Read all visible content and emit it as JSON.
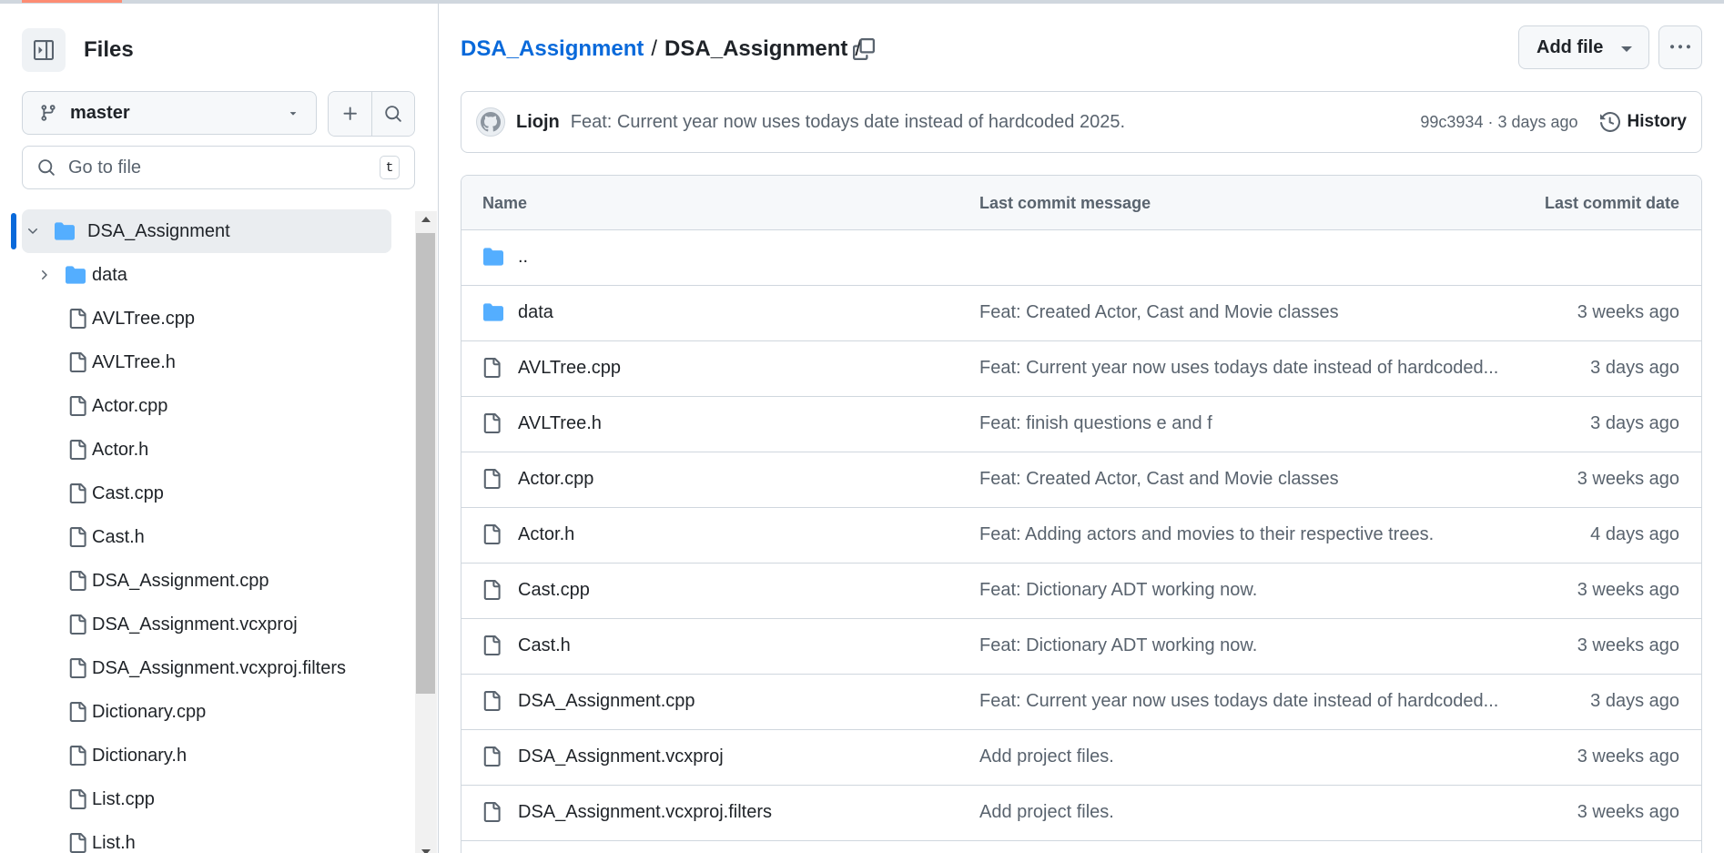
{
  "sidebar": {
    "title": "Files",
    "branch": "master",
    "search_placeholder": "Go to file",
    "search_shortcut": "t",
    "tree": [
      {
        "label": "DSA_Assignment",
        "type": "folder-open",
        "depth": 0,
        "expanded": true,
        "active": true
      },
      {
        "label": "data",
        "type": "folder",
        "depth": 1,
        "expanded": false
      },
      {
        "label": "AVLTree.cpp",
        "type": "file",
        "depth": 1
      },
      {
        "label": "AVLTree.h",
        "type": "file",
        "depth": 1
      },
      {
        "label": "Actor.cpp",
        "type": "file",
        "depth": 1
      },
      {
        "label": "Actor.h",
        "type": "file",
        "depth": 1
      },
      {
        "label": "Cast.cpp",
        "type": "file",
        "depth": 1
      },
      {
        "label": "Cast.h",
        "type": "file",
        "depth": 1
      },
      {
        "label": "DSA_Assignment.cpp",
        "type": "file",
        "depth": 1
      },
      {
        "label": "DSA_Assignment.vcxproj",
        "type": "file",
        "depth": 1
      },
      {
        "label": "DSA_Assignment.vcxproj.filters",
        "type": "file",
        "depth": 1
      },
      {
        "label": "Dictionary.cpp",
        "type": "file",
        "depth": 1
      },
      {
        "label": "Dictionary.h",
        "type": "file",
        "depth": 1
      },
      {
        "label": "List.cpp",
        "type": "file",
        "depth": 1
      },
      {
        "label": "List.h",
        "type": "file",
        "depth": 1
      }
    ]
  },
  "breadcrumb": {
    "repo": "DSA_Assignment",
    "separator": "/",
    "current": "DSA_Assignment"
  },
  "actions": {
    "add_file": "Add file"
  },
  "latest_commit": {
    "author": "Liojn",
    "message": "Feat: Current year now uses todays date instead of hardcoded 2025.",
    "meta": "99c3934 · 3 days ago",
    "history_label": "History"
  },
  "table": {
    "headers": {
      "name": "Name",
      "message": "Last commit message",
      "date": "Last commit date"
    },
    "rows": [
      {
        "name": "..",
        "type": "folder",
        "message": "",
        "date": ""
      },
      {
        "name": "data",
        "type": "folder",
        "message": "Feat: Created Actor, Cast and Movie classes",
        "date": "3 weeks ago"
      },
      {
        "name": "AVLTree.cpp",
        "type": "file",
        "message": "Feat: Current year now uses todays date instead of hardcoded...",
        "date": "3 days ago"
      },
      {
        "name": "AVLTree.h",
        "type": "file",
        "message": "Feat: finish questions e and f",
        "date": "3 days ago"
      },
      {
        "name": "Actor.cpp",
        "type": "file",
        "message": "Feat: Created Actor, Cast and Movie classes",
        "date": "3 weeks ago"
      },
      {
        "name": "Actor.h",
        "type": "file",
        "message": "Feat: Adding actors and movies to their respective trees.",
        "date": "4 days ago"
      },
      {
        "name": "Cast.cpp",
        "type": "file",
        "message": "Feat: Dictionary ADT working now.",
        "date": "3 weeks ago"
      },
      {
        "name": "Cast.h",
        "type": "file",
        "message": "Feat: Dictionary ADT working now.",
        "date": "3 weeks ago"
      },
      {
        "name": "DSA_Assignment.cpp",
        "type": "file",
        "message": "Feat: Current year now uses todays date instead of hardcoded...",
        "date": "3 days ago"
      },
      {
        "name": "DSA_Assignment.vcxproj",
        "type": "file",
        "message": "Add project files.",
        "date": "3 weeks ago"
      },
      {
        "name": "DSA_Assignment.vcxproj.filters",
        "type": "file",
        "message": "Add project files.",
        "date": "3 weeks ago"
      }
    ]
  },
  "colors": {
    "link": "#0969da",
    "folder": "#54aeff",
    "muted": "#59636e",
    "border": "#d0d7de"
  }
}
